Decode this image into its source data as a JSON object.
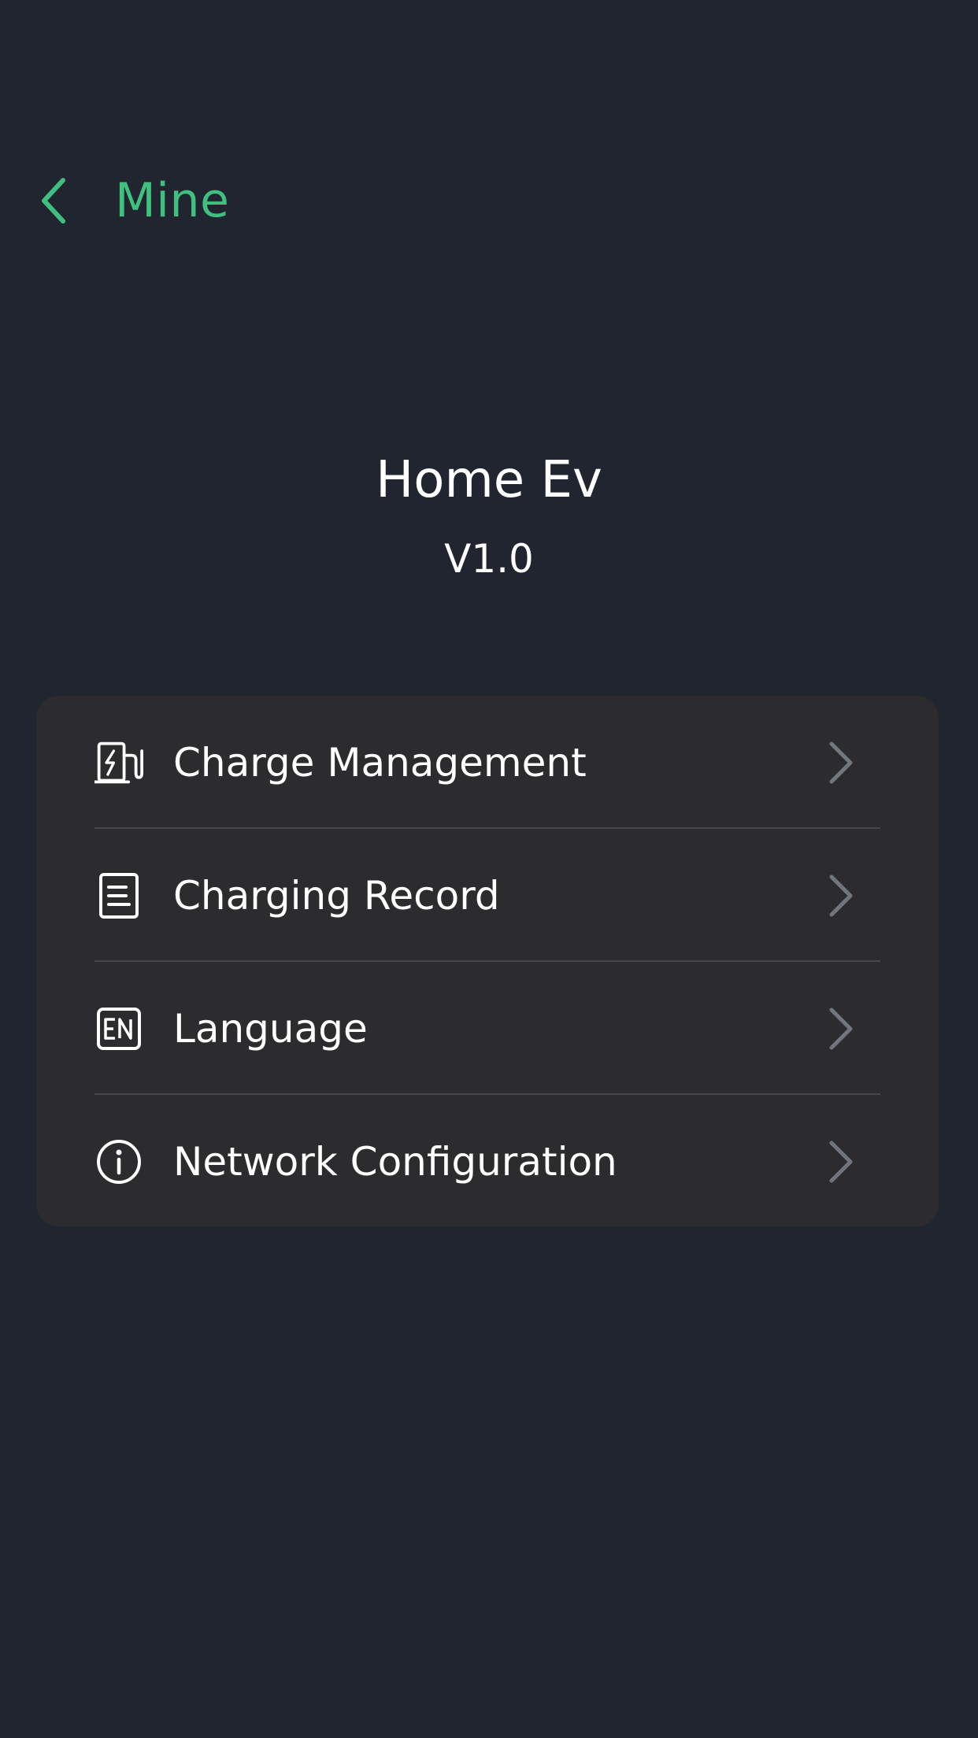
{
  "header": {
    "back_label": "Mine",
    "accent_color": "#3fc07f",
    "back_icon": "chevron-left-icon"
  },
  "app": {
    "name": "Home Ev",
    "version": "V1.0"
  },
  "menu": {
    "items": [
      {
        "label": "Charge Management",
        "icon": "charging-station-icon"
      },
      {
        "label": "Charging Record",
        "icon": "document-icon"
      },
      {
        "label": "Language",
        "icon": "language-en-icon"
      },
      {
        "label": "Network Configuration",
        "icon": "info-icon"
      }
    ],
    "chevron_icon": "chevron-right-icon"
  },
  "colors": {
    "background": "#212530",
    "card": "#2c2c2e",
    "divider": "#46474c",
    "chevron": "#71757e"
  }
}
